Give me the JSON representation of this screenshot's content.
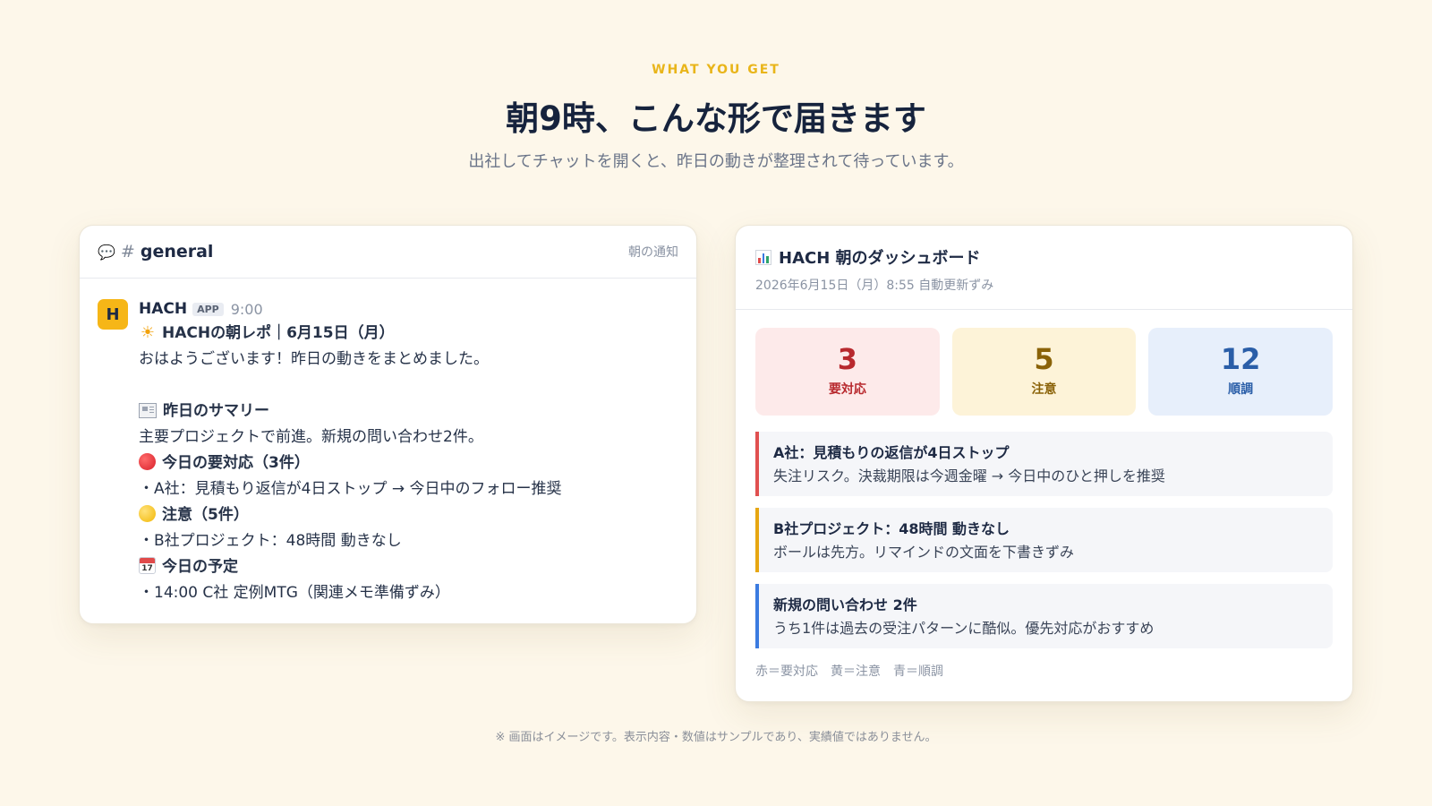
{
  "header": {
    "eyebrow": "WHAT YOU GET",
    "title": "朝9時、こんな形で届きます",
    "subtitle": "出社してチャットを開くと、昨日の動きが整理されて待っています。"
  },
  "chat": {
    "channel_hash": "#",
    "channel_name": "general",
    "header_right": "朝の通知",
    "message": {
      "avatar_letter": "H",
      "sender": "HACH",
      "badge": "APP",
      "time": "9:00",
      "lines": {
        "title": "HACHの朝レポ｜6月15日（月）",
        "greeting": "おはようございます！昨日の動きをまとめました。",
        "summary_heading": "昨日のサマリー",
        "summary_text": "主要プロジェクトで前進。新規の問い合わせ2件。",
        "urgent_heading": "今日の要対応（3件）",
        "urgent_item": "・A社：見積もり返信が4日ストップ → 今日中のフォロー推奨",
        "caution_heading": "注意（5件）",
        "caution_item": "・B社プロジェクト：48時間 動きなし",
        "schedule_heading": "今日の予定",
        "schedule_item": "・14:00 C社 定例MTG（関連メモ準備ずみ）",
        "calendar_day": "17"
      }
    }
  },
  "dashboard": {
    "title": "HACH 朝のダッシュボード",
    "subtitle": "2026年6月15日（月）8:55 自動更新ずみ",
    "stats": [
      {
        "value": "3",
        "label": "要対応",
        "color": "#b8292e"
      },
      {
        "value": "5",
        "label": "注意",
        "color": "#8a6208"
      },
      {
        "value": "12",
        "label": "順調",
        "color": "#2a5ea8"
      }
    ],
    "alerts": [
      {
        "title": "A社：見積もりの返信が4日ストップ",
        "text": "失注リスク。決裁期限は今週金曜 → 今日中のひと押しを推奨"
      },
      {
        "title": "B社プロジェクト：48時間 動きなし",
        "text": "ボールは先方。リマインドの文面を下書きずみ"
      },
      {
        "title": "新規の問い合わせ 2件",
        "text": "うち1件は過去の受注パターンに酷似。優先対応がおすすめ"
      }
    ],
    "legend": "赤＝要対応　黄＝注意　青＝順調"
  },
  "footnote": "※ 画面はイメージです。表示内容・数値はサンプルであり、実績値ではありません。",
  "icons": {
    "chat": "speech-bubble-icon",
    "report": "sun-icon",
    "summary": "newspaper-icon",
    "urgent": "red-circle-icon",
    "caution": "yellow-circle-icon",
    "schedule": "calendar-icon",
    "dashboard": "bar-chart-icon"
  }
}
